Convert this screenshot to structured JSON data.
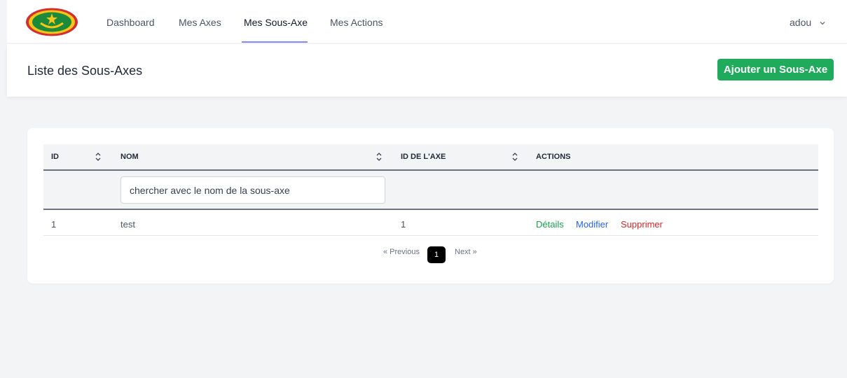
{
  "nav": {
    "links": [
      {
        "label": "Dashboard"
      },
      {
        "label": "Mes Axes"
      },
      {
        "label": "Mes Sous-Axe"
      },
      {
        "label": "Mes Actions"
      }
    ],
    "active": "Mes Sous-Axe",
    "user": "adou",
    "user_menu_icon": "chevron-down-icon"
  },
  "header": {
    "title": "Liste des Sous-Axes",
    "add_button": "Ajouter un Sous-Axe"
  },
  "table": {
    "columns": [
      "ID",
      "NOM",
      "ID DE L'AXE",
      "ACTIONS"
    ],
    "search_placeholder": "chercher avec le nom de la sous-axe",
    "rows": [
      {
        "id": "1",
        "nom": "test",
        "axe_id": "1",
        "actions": [
          "Détails",
          "Modifier",
          "Supprimer"
        ]
      }
    ]
  },
  "pagination": {
    "previous": "« Previous",
    "current": "1",
    "next": "Next »"
  },
  "colors": {
    "accent_green": "#1fab5b",
    "details_link": "#16a34a",
    "modifier_link": "#2563eb",
    "supprimer_link": "#dc2626",
    "active_tab_underline": "#818cf8"
  }
}
